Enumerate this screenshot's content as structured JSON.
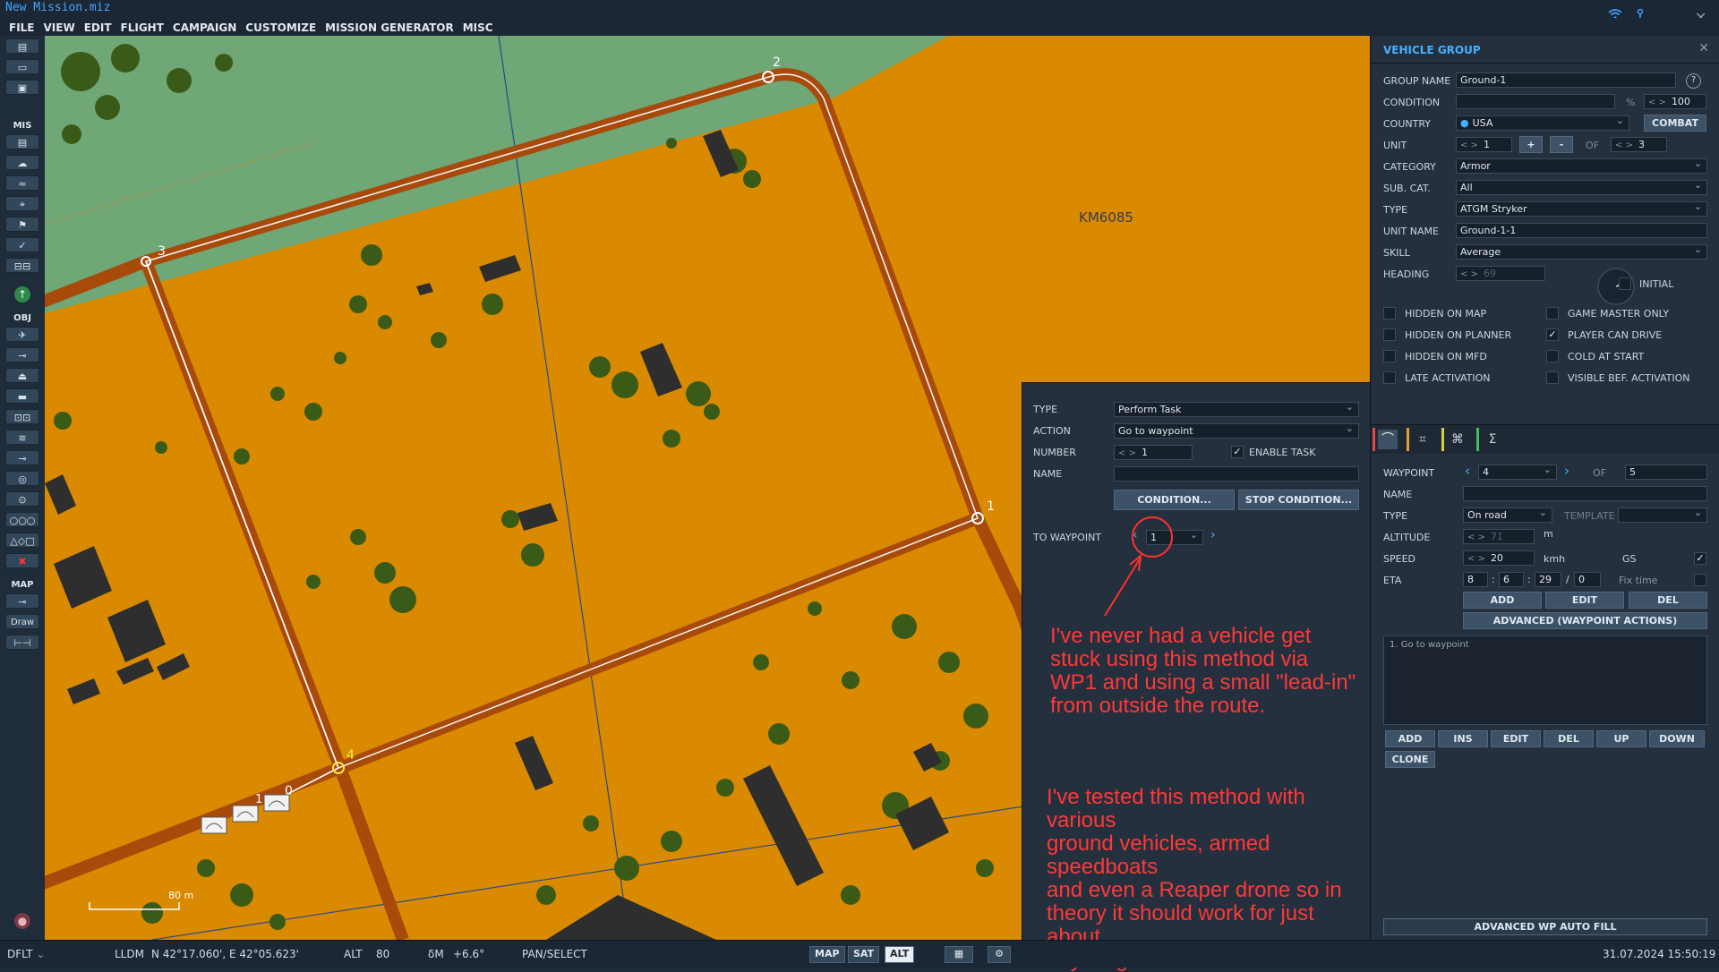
{
  "window": {
    "title": "New Mission.miz"
  },
  "menu": [
    "FILE",
    "VIEW",
    "EDIT",
    "FLIGHT",
    "CAMPAIGN",
    "CUSTOMIZE",
    "MISSION GENERATOR",
    "MISC"
  ],
  "toolbar": {
    "mis_label": "MIS",
    "obj_label": "OBJ",
    "map_label": "MAP",
    "draw_label": "Draw"
  },
  "map": {
    "grid_label": "KM6085",
    "scale_label": "80 m",
    "waypoints": [
      "0",
      "1",
      "2",
      "3",
      "4"
    ],
    "unit_index_label": "1"
  },
  "task_panel": {
    "type_label": "TYPE",
    "type_value": "Perform Task",
    "action_label": "ACTION",
    "action_value": "Go to waypoint",
    "number_label": "NUMBER",
    "number_value": "1",
    "enable_task_label": "ENABLE TASK",
    "enable_task_checked": true,
    "name_label": "NAME",
    "name_value": "",
    "condition_button": "CONDITION...",
    "stop_condition_button": "STOP CONDITION...",
    "to_waypoint_label": "TO WAYPOINT",
    "to_waypoint_value": "1"
  },
  "annotations": {
    "note_1": [
      "I've never had a vehicle get",
      "stuck using this method via",
      "WP1 and using a small \"lead-in\"",
      "from outside the route."
    ],
    "note_2": [
      "I've tested this method with various",
      "ground vehicles, armed speedboats",
      "and even a Reaper drone so in",
      "theory it should work for just about",
      "anything."
    ]
  },
  "vehicle_group": {
    "title": "VEHICLE GROUP",
    "group_name_label": "GROUP NAME",
    "group_name_value": "Ground-1",
    "help_icon": "?",
    "condition_label": "CONDITION",
    "condition_pct": "%",
    "condition_value": "100",
    "country_label": "COUNTRY",
    "country_value": "USA",
    "combat_button": "COMBAT",
    "unit_label": "UNIT",
    "unit_value": "1",
    "unit_plus": "+",
    "unit_minus": "-",
    "unit_of": "OF",
    "unit_total": "3",
    "category_label": "CATEGORY",
    "category_value": "Armor",
    "subcat_label": "SUB. CAT.",
    "subcat_value": "All",
    "type_label": "TYPE",
    "type_value": "ATGM Stryker",
    "unit_name_label": "UNIT NAME",
    "unit_name_value": "Ground-1-1",
    "skill_label": "SKILL",
    "skill_value": "Average",
    "heading_label": "HEADING",
    "heading_value": "69",
    "initial_label": "INITIAL",
    "checkboxes_left": [
      {
        "label": "HIDDEN ON MAP",
        "checked": false
      },
      {
        "label": "HIDDEN ON PLANNER",
        "checked": false
      },
      {
        "label": "HIDDEN ON MFD",
        "checked": false
      },
      {
        "label": "LATE ACTIVATION",
        "checked": false
      }
    ],
    "checkboxes_right": [
      {
        "label": "GAME MASTER ONLY",
        "checked": false
      },
      {
        "label": "PLAYER CAN DRIVE",
        "checked": true
      },
      {
        "label": "COLD AT START",
        "checked": false
      },
      {
        "label": "VISIBLE BEF. ACTIVATION",
        "checked": false
      }
    ],
    "waypoint_label": "WAYPOINT",
    "waypoint_value": "4",
    "waypoint_of": "OF",
    "waypoint_total": "5",
    "wp_name_label": "NAME",
    "wp_name_value": "",
    "wp_type_label": "TYPE",
    "wp_type_value": "On road",
    "template_label": "TEMPLATE",
    "template_value": "",
    "altitude_label": "ALTITUDE",
    "altitude_value": "71",
    "altitude_unit": "m",
    "speed_label": "SPEED",
    "speed_value": "20",
    "speed_unit": "kmh",
    "gs_label": "GS",
    "gs_checked": true,
    "eta_label": "ETA",
    "eta_h": "8",
    "eta_m": "6",
    "eta_s": "29",
    "eta_d": "0",
    "fix_time_label": "Fix time",
    "wp_add": "ADD",
    "wp_edit": "EDIT",
    "wp_del": "DEL",
    "advanced_actions": "ADVANCED (WAYPOINT ACTIONS)",
    "actions_list": [
      "1. Go to waypoint"
    ],
    "list_add": "ADD",
    "list_ins": "INS",
    "list_edit": "EDIT",
    "list_del": "DEL",
    "list_up": "UP",
    "list_down": "DOWN",
    "list_clone": "CLONE",
    "auto_fill": "ADVANCED WP AUTO FILL"
  },
  "statusbar": {
    "profile": "DFLT",
    "coord_mode": "LLDM",
    "coords": "N 42°17.060', E 42°05.623'",
    "alt_label": "ALT",
    "alt_value": "80",
    "magvar_label": "δM",
    "magvar_value": "+6.6°",
    "mode": "PAN/SELECT",
    "map_btn": "MAP",
    "sat_btn": "SAT",
    "alt_btn": "ALT",
    "datetime": "31.07.2024 15:50:19"
  }
}
